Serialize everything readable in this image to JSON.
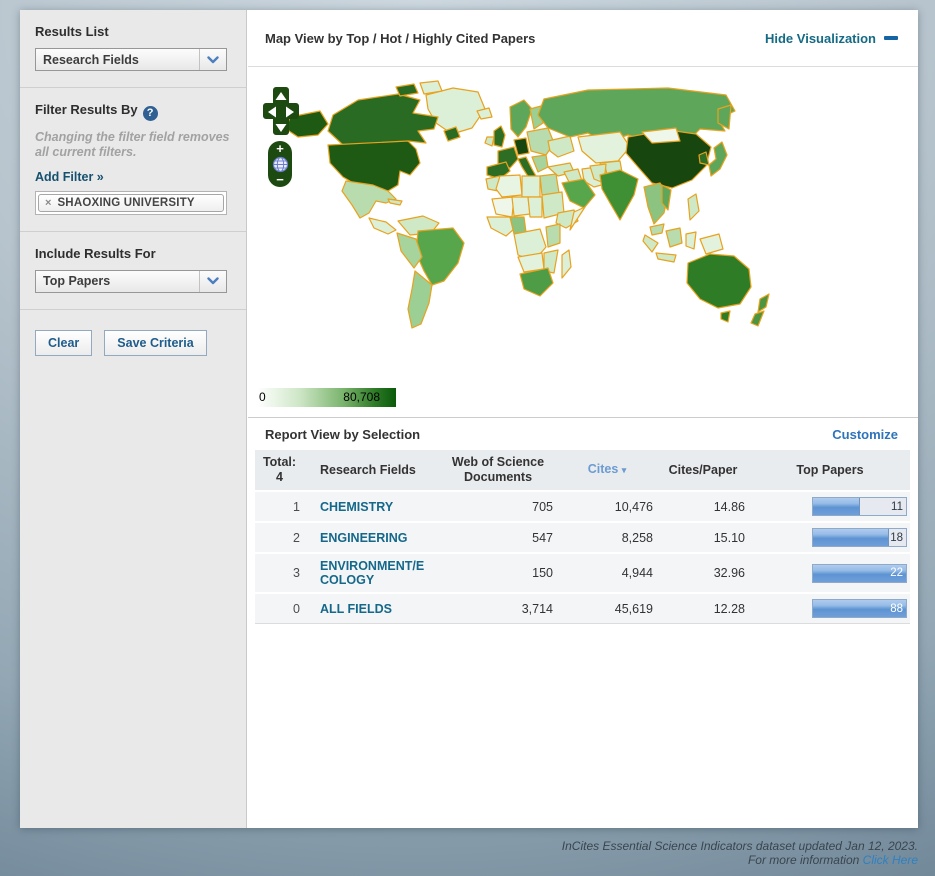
{
  "sidebar": {
    "results_list": {
      "label": "Results List",
      "selected": "Research Fields"
    },
    "filter": {
      "label": "Filter Results By",
      "help_glyph": "?",
      "note_line1": "Changing the filter field removes",
      "note_line2": "all current filters.",
      "add_filter": "Add Filter »",
      "tag": {
        "close_glyph": "×",
        "label": "SHAOXING UNIVERSITY"
      }
    },
    "include": {
      "label": "Include Results For",
      "selected": "Top Papers"
    },
    "buttons": {
      "clear": "Clear",
      "save": "Save Criteria"
    }
  },
  "map": {
    "title": "Map View by Top / Hot / Highly Cited Papers",
    "hide_link": "Hide Visualization",
    "controls": {
      "zoom_in": "+",
      "zoom_out": "−"
    },
    "legend": {
      "min": "0",
      "max": "80,708",
      "gradient_start": "#ffffff",
      "gradient_end": "#0a5a0a"
    },
    "border_color": "#e8a21e"
  },
  "report": {
    "title": "Report View by Selection",
    "customize": "Customize",
    "total_label": "Total:",
    "total_value": "4",
    "columns": {
      "field": "Research Fields",
      "docs_line1": "Web of Science",
      "docs_line2": "Documents",
      "cites": "Cites",
      "sort_arrow": "▾",
      "cites_per_paper": "Cites/Paper",
      "top_papers": "Top Papers"
    },
    "sorted_column": "Cites",
    "rows": [
      {
        "rank": "1",
        "field": "CHEMISTRY",
        "docs": "705",
        "cites": "10,476",
        "cites_per_paper": "14.86",
        "top_papers": "11",
        "bar_pct": 50
      },
      {
        "rank": "2",
        "field": "ENGINEERING",
        "docs": "547",
        "cites": "8,258",
        "cites_per_paper": "15.10",
        "top_papers": "18",
        "bar_pct": 82
      },
      {
        "rank": "3",
        "field": "ENVIRONMENT/ECOLOGY",
        "docs": "150",
        "cites": "4,944",
        "cites_per_paper": "32.96",
        "top_papers": "22",
        "bar_pct": 100
      },
      {
        "rank": "0",
        "field": "ALL FIELDS",
        "docs": "3,714",
        "cites": "45,619",
        "cites_per_paper": "12.28",
        "top_papers": "88",
        "bar_pct": 100
      }
    ]
  },
  "footer": {
    "line1": "InCites Essential Science Indicators dataset updated Jan 12, 2023.",
    "line2_prefix": "For more information ",
    "line2_link": "Click Here"
  }
}
